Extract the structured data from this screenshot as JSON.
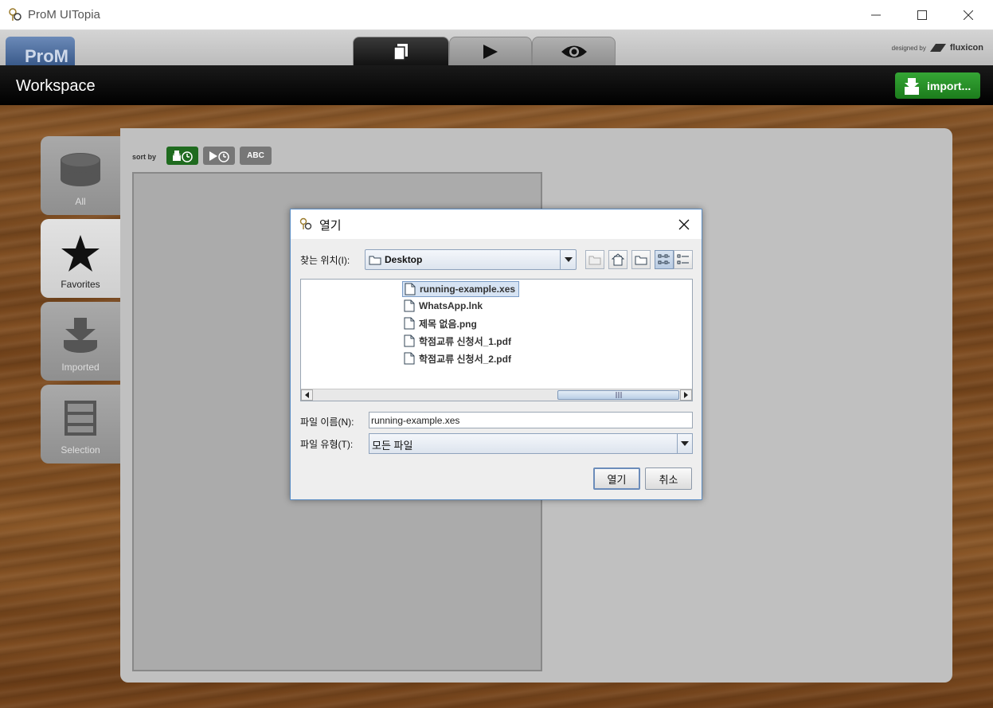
{
  "window": {
    "title": "ProM UITopia"
  },
  "header": {
    "logo_text": "ProM",
    "designed_by": "designed by",
    "brand": "fluxicon"
  },
  "workspace": {
    "title": "Workspace",
    "import_label": "import..."
  },
  "sidebar": {
    "items": [
      {
        "label": "All",
        "icon": "database-icon",
        "active": false
      },
      {
        "label": "Favorites",
        "icon": "star-icon",
        "active": true
      },
      {
        "label": "Imported",
        "icon": "import-icon",
        "active": false
      },
      {
        "label": "Selection",
        "icon": "selection-icon",
        "active": false
      }
    ]
  },
  "sort": {
    "label": "sort by",
    "abc_label": "ABC"
  },
  "dialog": {
    "title": "열기",
    "lookin_label": "찾는 위치(I):",
    "lookin_value": "Desktop",
    "files": [
      {
        "name": "running-example.xes",
        "selected": true
      },
      {
        "name": "WhatsApp.lnk",
        "selected": false
      },
      {
        "name": "제목 없음.png",
        "selected": false
      },
      {
        "name": "학점교류 신청서_1.pdf",
        "selected": false
      },
      {
        "name": "학점교류 신청서_2.pdf",
        "selected": false
      }
    ],
    "filename_label": "파일 이름(N):",
    "filename_value": "running-example.xes",
    "filetype_label": "파일 유형(T):",
    "filetype_value": "모든 파일",
    "open_label": "열기",
    "cancel_label": "취소"
  },
  "colors": {
    "accent_green": "#1c7c1c",
    "selection_blue": "#d6e3f3"
  }
}
